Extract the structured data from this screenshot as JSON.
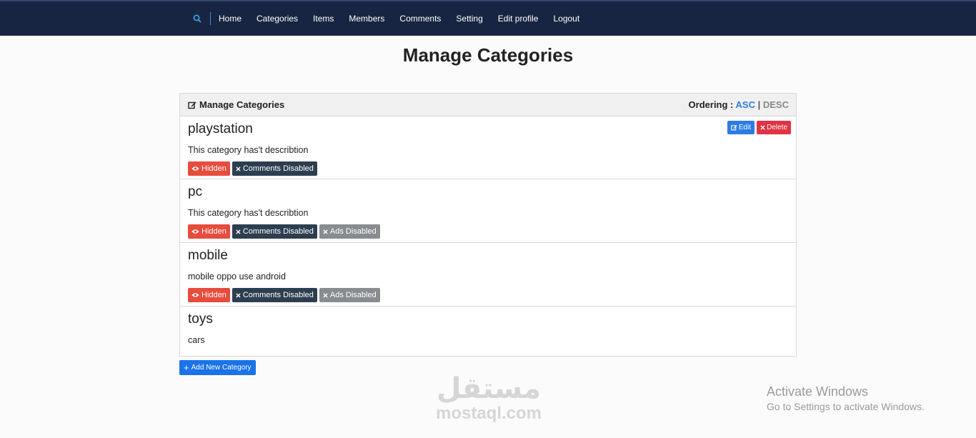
{
  "nav": {
    "items": [
      "Home",
      "Categories",
      "Items",
      "Members",
      "Comments",
      "Setting",
      "Edit profile",
      "Logout"
    ]
  },
  "page_title": "Manage Categories",
  "panel": {
    "heading": "Manage Categories",
    "ordering_label": "Ordering :",
    "asc": "ASC",
    "separator": "|",
    "desc": "DESC"
  },
  "actions": {
    "edit": "Edit",
    "delete": "Delete"
  },
  "categories": [
    {
      "name": "playstation",
      "description": "This category has't describtion",
      "badges": [
        "Hidden",
        "Comments Disabled"
      ]
    },
    {
      "name": "pc",
      "description": "This category has't describtion",
      "badges": [
        "Hidden",
        "Comments Disabled",
        "Ads Disabled"
      ]
    },
    {
      "name": "mobile",
      "description": "mobile oppo use android",
      "badges": [
        "Hidden",
        "Comments Disabled",
        "Ads Disabled"
      ]
    },
    {
      "name": "toys",
      "description": "cars",
      "badges": []
    }
  ],
  "add_button": "Add New Category",
  "watermark": {
    "arabic": "مستقل",
    "latin": "mostaql.com"
  },
  "activation": {
    "title": "Activate Windows",
    "subtitle": "Go to Settings to activate Windows."
  },
  "colors": {
    "navbar": "#182542",
    "accent": "#2c7be5",
    "hidden_badge": "#e74c3c",
    "comments_badge": "#2c3e50",
    "ads_badge": "#888c8f",
    "delete": "#e03444"
  }
}
